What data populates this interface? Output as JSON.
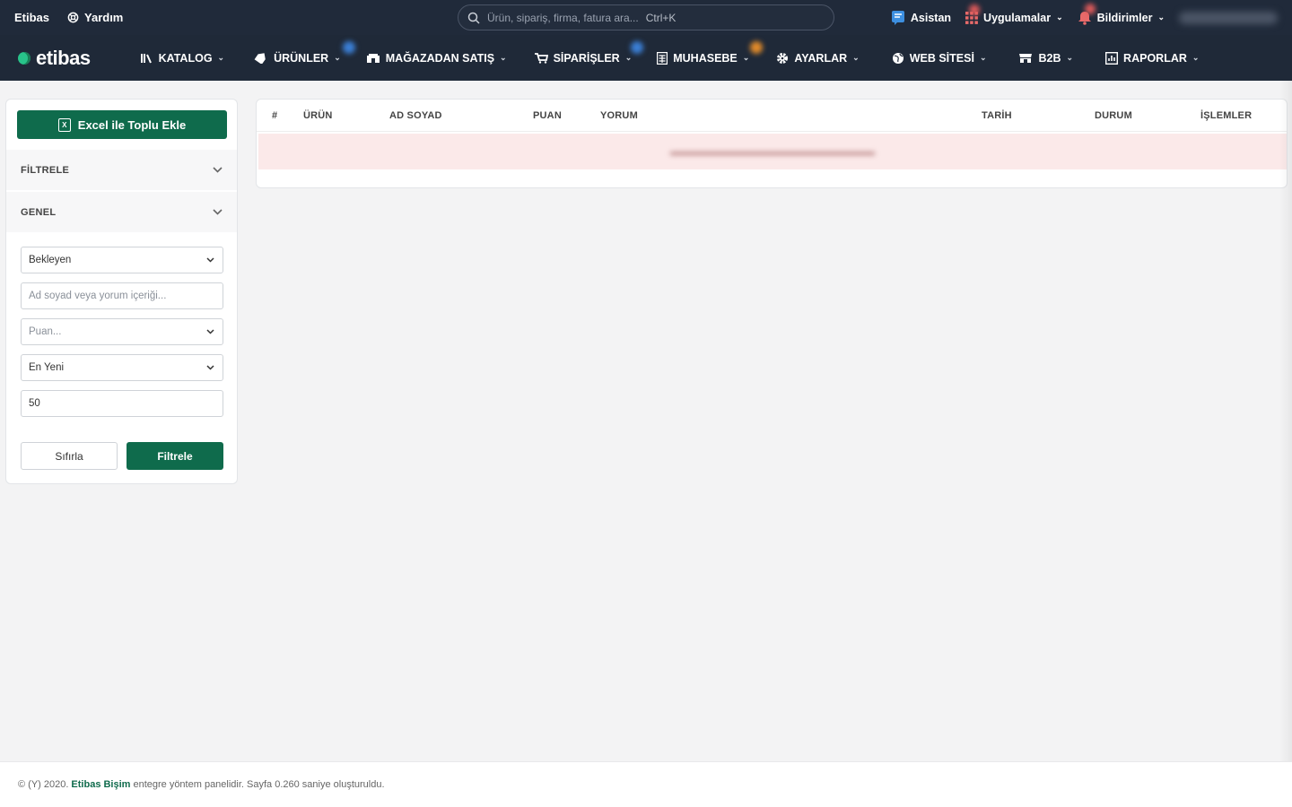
{
  "topbar": {
    "brand": "Etibas",
    "help_label": "Yardım",
    "search_placeholder": "Ürün, sipariş, firma, fatura ara...",
    "search_shortcut": "Ctrl+K",
    "assistant_label": "Asistan",
    "apps_label": "Uygulamalar",
    "notifications_label": "Bildirimler"
  },
  "navbar": {
    "logo_text": "etibas",
    "menu": [
      {
        "label": "KATALOG"
      },
      {
        "label": "ÜRÜNLER"
      },
      {
        "label": "MAĞAZADAN SATIŞ"
      },
      {
        "label": "SİPARİŞLER"
      },
      {
        "label": "MUHASEBE"
      },
      {
        "label": "AYARLAR"
      },
      {
        "label": "WEB SİTESİ"
      },
      {
        "label": "B2B"
      },
      {
        "label": "RAPORLAR"
      }
    ]
  },
  "sidebar": {
    "excel_button": "Excel ile Toplu Ekle",
    "filter_section": "FİLTRELE",
    "general_section": "GENEL",
    "status_select": "Bekleyen",
    "search_placeholder": "Ad soyad veya yorum içeriği...",
    "rating_placeholder": "Puan...",
    "sort_select": "En Yeni",
    "limit_value": "50",
    "reset_button": "Sıfırla",
    "filter_button": "Filtrele"
  },
  "table": {
    "columns": [
      "#",
      "ÜRÜN",
      "AD SOYAD",
      "PUAN",
      "YORUM",
      "TARİH",
      "DURUM",
      "İŞLEMLER"
    ]
  },
  "footer": {
    "prefix": "© (Y) 2020.",
    "link": "Etibas Bişim",
    "suffix": "entegre yöntem panelidir. Sayfa 0.260 saniye oluşturuldu."
  },
  "colors": {
    "topbar": "#202a3a",
    "navbar": "#1f2938",
    "accent": "#0f6b4c",
    "empty_row": "#fbe9e9"
  }
}
